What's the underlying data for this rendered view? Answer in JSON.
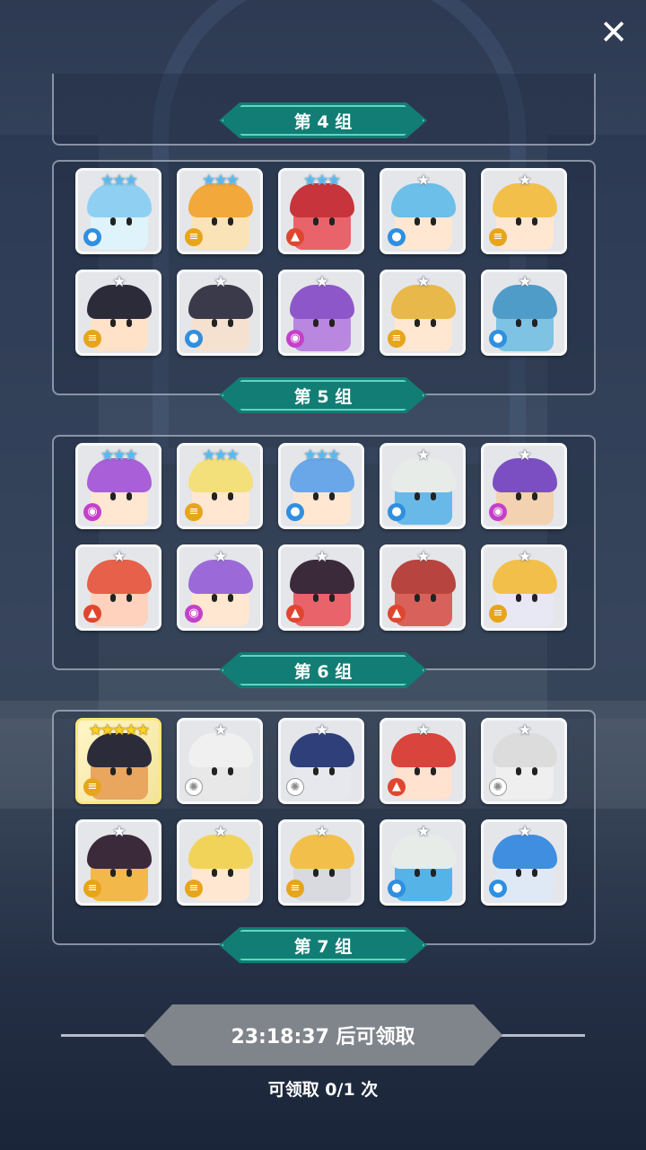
{
  "colors": {
    "label_bg": "#127d74",
    "claim_btn": "#80858c"
  },
  "close_icon": "close-icon",
  "groups": [
    {
      "label": "第 4 组",
      "cards": [
        {
          "stars": "★★★",
          "tier": "blue",
          "elem": "water",
          "hair": "#8fd0f2",
          "skin": "#dff3fb"
        },
        {
          "stars": "★★★",
          "tier": "blue",
          "elem": "wind",
          "hair": "#f2a83a",
          "skin": "#fbe3b8"
        },
        {
          "stars": "★★★",
          "tier": "blue",
          "elem": "fire",
          "hair": "#c8343b",
          "skin": "#e9646a"
        },
        {
          "stars": "★",
          "tier": "",
          "elem": "water",
          "hair": "#6bbfe8",
          "skin": "#ffe7d2"
        },
        {
          "stars": "★",
          "tier": "",
          "elem": "wind",
          "hair": "#f2c04a",
          "skin": "#ffe7d2"
        },
        {
          "stars": "★",
          "tier": "",
          "elem": "wind",
          "hair": "#2b2b3a",
          "skin": "#ffe2c8"
        },
        {
          "stars": "★",
          "tier": "",
          "elem": "water",
          "hair": "#3a3a4a",
          "skin": "#f4e1d0"
        },
        {
          "stars": "★",
          "tier": "",
          "elem": "dark",
          "hair": "#8e57c9",
          "skin": "#b987e0"
        },
        {
          "stars": "★",
          "tier": "",
          "elem": "wind",
          "hair": "#e9b84a",
          "skin": "#ffe7d2"
        },
        {
          "stars": "★",
          "tier": "",
          "elem": "water",
          "hair": "#4f9cc9",
          "skin": "#7ec2e4"
        }
      ]
    },
    {
      "label": "第 5 组",
      "cards": [
        {
          "stars": "★★★",
          "tier": "blue",
          "elem": "dark",
          "hair": "#a95fd8",
          "skin": "#ffe7d2"
        },
        {
          "stars": "★★★",
          "tier": "blue",
          "elem": "wind",
          "hair": "#f4e07a",
          "skin": "#ffe7d2"
        },
        {
          "stars": "★★★",
          "tier": "blue",
          "elem": "water",
          "hair": "#6aa7e8",
          "skin": "#ffe7d2"
        },
        {
          "stars": "★",
          "tier": "",
          "elem": "water",
          "hair": "#e8ece9",
          "skin": "#69b9e8"
        },
        {
          "stars": "★",
          "tier": "",
          "elem": "dark",
          "hair": "#7b4fc2",
          "skin": "#f2d2b0"
        },
        {
          "stars": "★",
          "tier": "",
          "elem": "fire",
          "hair": "#e7604a",
          "skin": "#ffd2bd"
        },
        {
          "stars": "★",
          "tier": "",
          "elem": "dark",
          "hair": "#9b6ad8",
          "skin": "#ffe7d2"
        },
        {
          "stars": "★",
          "tier": "",
          "elem": "fire",
          "hair": "#3a2a3a",
          "skin": "#e9646a"
        },
        {
          "stars": "★",
          "tier": "",
          "elem": "fire",
          "hair": "#b8443f",
          "skin": "#d9615c"
        },
        {
          "stars": "★",
          "tier": "",
          "elem": "wind",
          "hair": "#f2c04a",
          "skin": "#e8e8f4"
        }
      ]
    },
    {
      "label": "第 6 组",
      "cards": [
        {
          "stars": "★★★★★",
          "tier": "gold",
          "elem": "wind",
          "hair": "#2b2b3a",
          "skin": "#e9a65e",
          "legend": true
        },
        {
          "stars": "★",
          "tier": "",
          "elem": "light",
          "hair": "#f0f0f0",
          "skin": "#e8e8e8"
        },
        {
          "stars": "★",
          "tier": "",
          "elem": "light",
          "hair": "#2e3f7a",
          "skin": "#e6e8ee"
        },
        {
          "stars": "★",
          "tier": "",
          "elem": "fire",
          "hair": "#d9443c",
          "skin": "#ffe2d0"
        },
        {
          "stars": "★",
          "tier": "",
          "elem": "light",
          "hair": "#dcdcdc",
          "skin": "#efefef"
        },
        {
          "stars": "★",
          "tier": "",
          "elem": "wind",
          "hair": "#3a2a3a",
          "skin": "#f2b84a"
        },
        {
          "stars": "★",
          "tier": "",
          "elem": "wind",
          "hair": "#f2d35a",
          "skin": "#ffe7d2"
        },
        {
          "stars": "★",
          "tier": "",
          "elem": "wind",
          "hair": "#f2c04a",
          "skin": "#d9d9e0"
        },
        {
          "stars": "★",
          "tier": "",
          "elem": "water",
          "hair": "#e8ece9",
          "skin": "#56b3e8"
        },
        {
          "stars": "★",
          "tier": "",
          "elem": "water",
          "hair": "#3f8ee0",
          "skin": "#dfe9f5"
        }
      ]
    }
  ],
  "footer_label": "第 7 组",
  "claim": {
    "button_label": "23:18:37 后可领取",
    "count_text": "可领取 0/1 次"
  }
}
